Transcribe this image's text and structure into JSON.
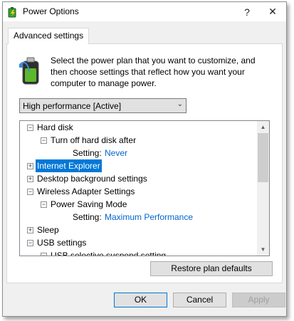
{
  "window": {
    "title": "Power Options",
    "help_glyph": "?",
    "close_glyph": "✕"
  },
  "tab": {
    "label": "Advanced settings"
  },
  "description": "Select the power plan that you want to customize, and then choose settings that reflect how you want your computer to manage power.",
  "plan_select": {
    "value": "High performance [Active]"
  },
  "tree": {
    "rows": [
      {
        "label": "Hard disk",
        "toggle": "−"
      },
      {
        "label": "Turn off hard disk after",
        "toggle": "−"
      },
      {
        "key": "Setting:",
        "value": "Never"
      },
      {
        "label": "Internet Explorer",
        "toggle": "+",
        "selected": true
      },
      {
        "label": "Desktop background settings",
        "toggle": "+"
      },
      {
        "label": "Wireless Adapter Settings",
        "toggle": "−"
      },
      {
        "label": "Power Saving Mode",
        "toggle": "−"
      },
      {
        "key": "Setting:",
        "value": "Maximum Performance"
      },
      {
        "label": "Sleep",
        "toggle": "+"
      },
      {
        "label": "USB settings",
        "toggle": "−"
      },
      {
        "label": "USB selective suspend setting",
        "toggle": "−"
      }
    ]
  },
  "buttons": {
    "restore": "Restore plan defaults",
    "ok": "OK",
    "cancel": "Cancel",
    "apply": "Apply"
  },
  "colors": {
    "selection": "#0078d7",
    "setting_value": "#0066cc"
  }
}
